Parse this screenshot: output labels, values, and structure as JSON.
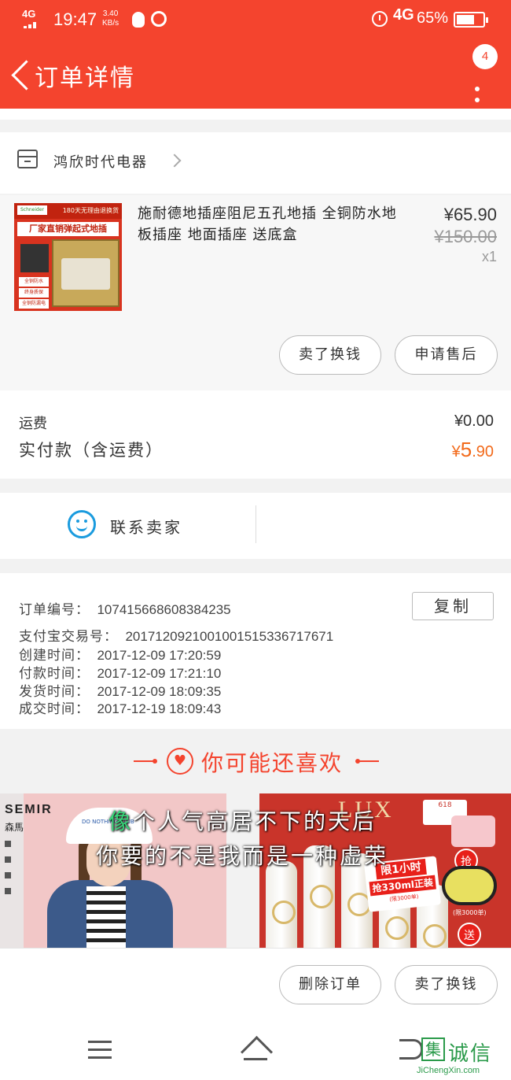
{
  "status_bar": {
    "network": "4G",
    "time": "19:47",
    "speed_value": "3.40",
    "speed_unit": "KB/s",
    "network2": "4G",
    "battery": "65%"
  },
  "header": {
    "title": "订单详情",
    "badge": "4"
  },
  "store": {
    "name": "鸿欣时代电器"
  },
  "product": {
    "name": "施耐德地插座阻尼五孔地插 全铜防水地板插座 地面插座 送底盒",
    "price": "¥65.90",
    "original_price": "¥150.00",
    "quantity": "x1",
    "thumb_top": "180天无理由退换货",
    "thumb_logo": "Schneider",
    "thumb_ad": "厂家直销弹起式地插",
    "thumb_tags": [
      "全铜防水",
      "终身质保",
      "全铜防漏电"
    ]
  },
  "product_actions": {
    "sell": "卖了换钱",
    "after_sale": "申请售后"
  },
  "payment": {
    "shipping_label": "运费",
    "shipping_value": "¥0.00",
    "paid_label": "实付款（含运费）",
    "paid_currency": "¥",
    "paid_int": "5",
    "paid_dec": ".90"
  },
  "contact": {
    "label": "联系卖家"
  },
  "order_info": {
    "copy_label": "复制",
    "lines": [
      {
        "label": "订单编号：",
        "value": "107415668608384235"
      },
      {
        "label": "支付宝交易号：",
        "value": "2017120921001001515336717671"
      },
      {
        "label": "创建时间：",
        "value": "2017-12-09 17:20:59"
      },
      {
        "label": "付款时间：",
        "value": "2017-12-09 17:21:10"
      },
      {
        "label": "发货时间：",
        "value": "2017-12-09 18:09:35"
      },
      {
        "label": "成交时间：",
        "value": "2017-12-19 18:09:43"
      }
    ]
  },
  "recommend": {
    "title": "你可能还喜欢",
    "left_brand": "SEMIR",
    "left_brand_cn": "森馬",
    "left_cap_text": "DO NOTHING CLUB",
    "right_brand": "LUX",
    "right_618": "618",
    "right_promo_1": "限1小时",
    "right_promo_2": "抢330ml正装",
    "right_promo_3": "(限3000单)",
    "right_grab": "抢",
    "right_send": "送",
    "right_note": "(限3000单)"
  },
  "lyrics": {
    "line1_hl": "像",
    "line1_rest": "个人气高居不下的天后",
    "line2": "你要的不是我而是一种虚荣"
  },
  "bottom_actions": {
    "delete": "删除订单",
    "sell": "卖了换钱"
  },
  "watermark": {
    "box": "集",
    "cn": "诚信",
    "en": "JiChengXin.com"
  },
  "colors": {
    "brand_red": "#f4442e",
    "price_orange": "#f26a1b",
    "contact_blue": "#1a9bde"
  }
}
